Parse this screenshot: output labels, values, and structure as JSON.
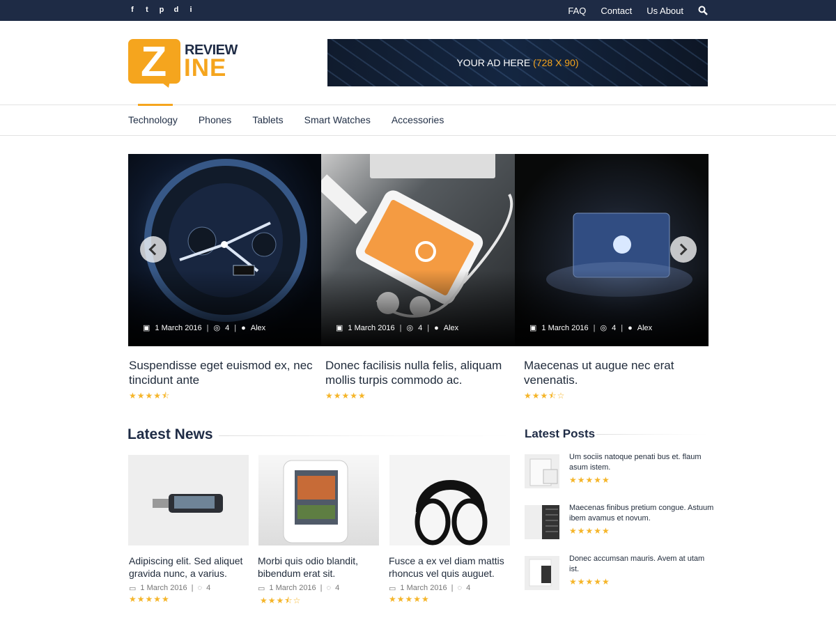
{
  "top": {
    "social": [
      "f",
      "t",
      "p",
      "d",
      "i"
    ],
    "links": [
      "FAQ",
      "Contact",
      "Us About"
    ],
    "search_icon": "search-icon"
  },
  "brand": {
    "top": "REVIEW",
    "mark": "Z",
    "bottom": "INE"
  },
  "ad": {
    "main": "YOUR AD HERE ",
    "size": "(728 X 90)"
  },
  "nav": [
    "Technology",
    "Phones",
    "Tablets",
    "Smart Watches",
    "Accessories"
  ],
  "featured": [
    {
      "date": "1 March 2016",
      "comments": "4",
      "author": "Alex",
      "title": "Suspendisse eget euismod ex, nec tincidunt ante",
      "stars": "★★★★⯪"
    },
    {
      "date": "1 March 2016",
      "comments": "4",
      "author": "Alex",
      "title": "Donec facilisis nulla felis, aliquam mollis turpis commodo ac.",
      "stars": "★★★★★"
    },
    {
      "date": "1 March 2016",
      "comments": "4",
      "author": "Alex",
      "title": "Maecenas ut augue nec erat venenatis.",
      "stars": "★★★⯪☆"
    }
  ],
  "latest_news": {
    "heading": "Latest News",
    "items": [
      {
        "title": "Adipiscing elit. Sed aliquet gravida nunc, a varius.",
        "date": "1 March 2016",
        "comments": "4",
        "stars": "★★★★★"
      },
      {
        "title": "Morbi quis odio blandit, bibendum erat sit.",
        "date": "1 March 2016",
        "comments": "4",
        "stars": "★★★⯪☆"
      },
      {
        "title": "Fusce a ex vel diam mattis rhoncus vel quis auguet.",
        "date": "1 March 2016",
        "comments": "4",
        "stars": "★★★★★"
      }
    ]
  },
  "latest_posts": {
    "heading": "Latest Posts",
    "items": [
      {
        "title": "Um sociis natoque penati bus et. flaum asum istem.",
        "stars": "★★★★★"
      },
      {
        "title": "Maecenas finibus pretium congue. Astuum ibem avamus et novum.",
        "stars": "★★★★★"
      },
      {
        "title": "Donec accumsan mauris. Avem at utam ist.",
        "stars": "★★★★★"
      }
    ]
  }
}
